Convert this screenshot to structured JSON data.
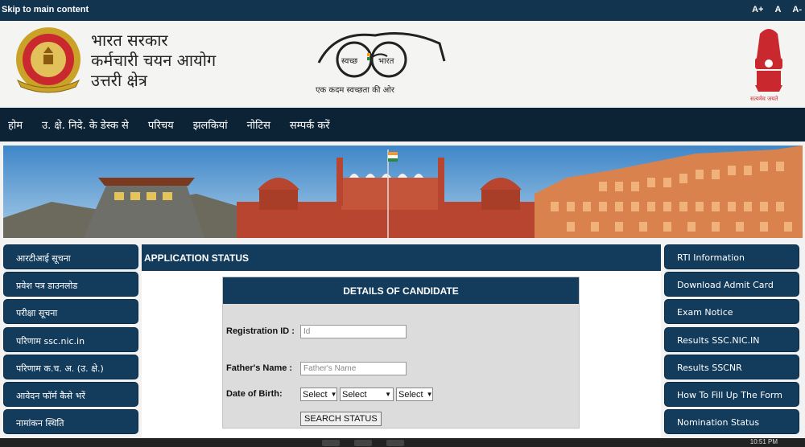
{
  "topbar": {
    "skip_link": "Skip to main content",
    "font_large": "A+",
    "font_normal": "A",
    "font_small": "A-"
  },
  "header": {
    "org_line1": "भारत सरकार",
    "org_line2": "कर्मचारी चयन आयोग",
    "org_line3": "उत्तरी क्षेत्र",
    "ssc_logo_text": "SELECTION COMMISSION",
    "ssc_logo_hindi": "कर्मचारी चयन आयोग",
    "swachh_left": "स्वच्छ",
    "swachh_right": "भारत",
    "swachh_tagline": "एक कदम स्वच्छता की ओर",
    "emblem_motto": "सत्यमेव जयते"
  },
  "nav": {
    "items": [
      "होम",
      "उ. क्षे. निदे. के डेस्क से",
      "परिचय",
      "झलकियां",
      "नोटिस",
      "सम्पर्क करें"
    ]
  },
  "left_sidebar": {
    "items": [
      "आरटीआई सूचना",
      "प्रवेश पत्र डाउनलोड",
      "परीक्षा सूचना",
      "परिणाम ssc.nic.in",
      "परिणाम क.च. अ. (उ. क्षे.)",
      "आवेदन फॉर्म कैसे भरें",
      "नामांकन स्थिति"
    ]
  },
  "right_sidebar": {
    "items": [
      "RTI Information",
      "Download Admit Card",
      "Exam Notice",
      "Results SSC.NIC.IN",
      "Results SSCNR",
      "How To Fill Up The Form",
      "Nomination Status"
    ]
  },
  "main": {
    "heading": "APPLICATION STATUS",
    "card_title": "DETAILS OF CANDIDATE",
    "reg_label": "Registration ID :",
    "reg_placeholder": "Id",
    "father_label": "Father's Name :",
    "father_placeholder": "Father's Name",
    "dob_label": "Date of Birth:",
    "dob_day": "Select",
    "dob_month": "Select",
    "dob_year": "Select",
    "search_button": "SEARCH STATUS"
  },
  "taskbar": {
    "time": "10:51 PM"
  },
  "colors": {
    "navy": "#123b5c",
    "dark_nav": "#0c2235",
    "topbar": "#13344f",
    "card_bg": "#dcdcdc"
  }
}
